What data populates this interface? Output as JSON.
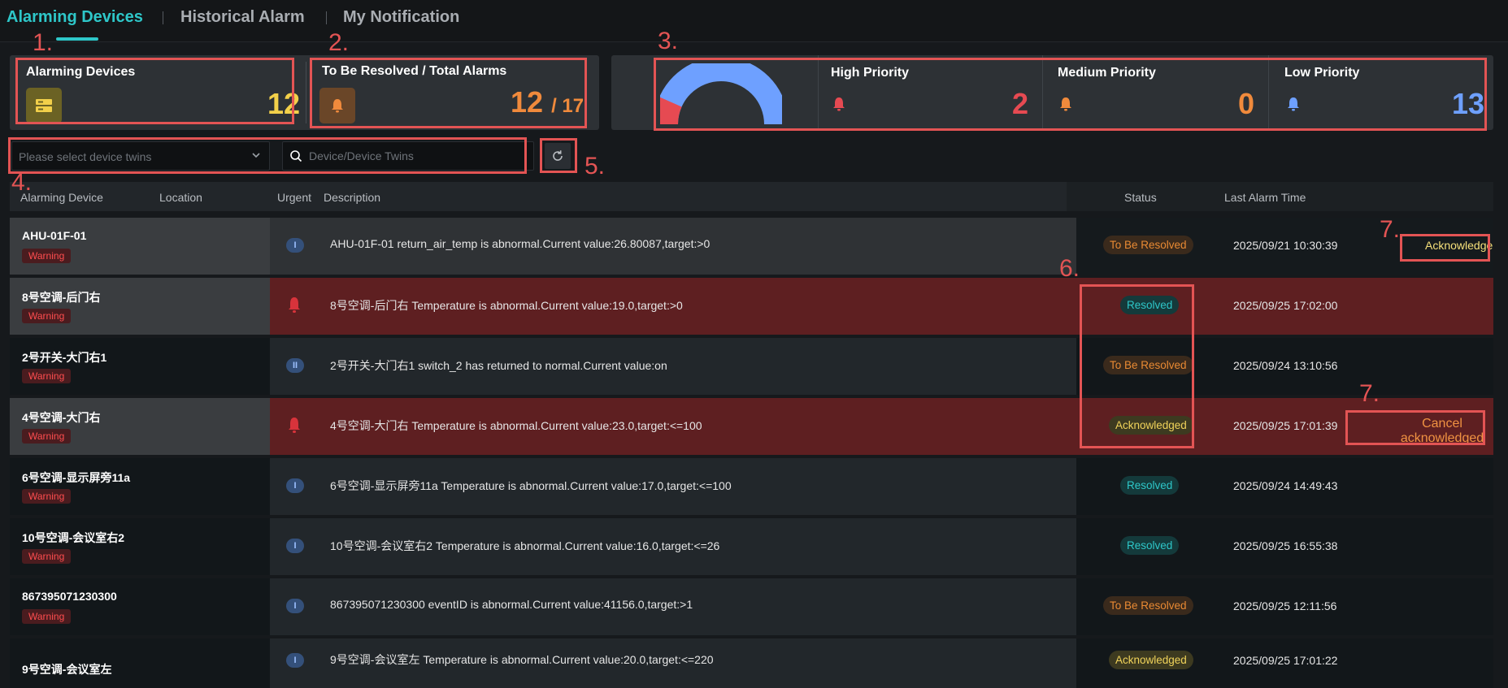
{
  "tabs": [
    {
      "label": "Alarming Devices"
    },
    {
      "label": "Historical Alarm"
    },
    {
      "label": "My Notification"
    }
  ],
  "annotations": [
    "1.",
    "2.",
    "3.",
    "4.",
    "5.",
    "6.",
    "7.",
    "7."
  ],
  "summary": {
    "alarming_devices": {
      "title": "Alarming Devices",
      "count": "12"
    },
    "to_be_resolved": {
      "title": "To Be Resolved / Total Alarms",
      "count": "12",
      "total": "/ 17"
    }
  },
  "priority": {
    "high": {
      "title": "High Priority",
      "count": "2",
      "color": "#e64a52"
    },
    "medium": {
      "title": "Medium Priority",
      "count": "0",
      "color": "#f08a3c"
    },
    "low": {
      "title": "Low Priority",
      "count": "13",
      "color": "#6ea0ff"
    },
    "gauge_fraction_high": 0.133
  },
  "filters": {
    "select_placeholder": "Please select device twins",
    "search_placeholder": "Device/Device Twins"
  },
  "table": {
    "headers": {
      "device": "Alarming Device",
      "location": "Location",
      "urgent": "Urgent",
      "description": "Description",
      "status": "Status",
      "time": "Last Alarm Time"
    },
    "rows": [
      {
        "name": "AHU-01F-01",
        "tag": "Warning",
        "urgent": "I",
        "desc": "AHU-01F-01 return_air_temp is abnormal.Current value:26.80087,target:>0",
        "status": "To Be Resolved",
        "time": "2025/09/21 10:30:39",
        "action": "Acknowledge"
      },
      {
        "name": "8号空调-后门右",
        "tag": "Warning",
        "urgent": "bell",
        "desc": "8号空调-后门右 Temperature is abnormal.Current value:19.0,target:>0",
        "status": "Resolved",
        "time": "2025/09/25 17:02:00",
        "action": ""
      },
      {
        "name": "2号开关-大门右1",
        "tag": "Warning",
        "urgent": "II",
        "desc": "2号开关-大门右1 switch_2 has returned to normal.Current value:on",
        "status": "To Be Resolved",
        "time": "2025/09/24 13:10:56",
        "action": ""
      },
      {
        "name": "4号空调-大门右",
        "tag": "Warning",
        "urgent": "bell",
        "desc": "4号空调-大门右 Temperature is abnormal.Current value:23.0,target:<=100",
        "status": "Acknowledged",
        "time": "2025/09/25 17:01:39",
        "action": "Cancel acknowledged"
      },
      {
        "name": "6号空调-显示屏旁11a",
        "tag": "Warning",
        "urgent": "I",
        "desc": "6号空调-显示屏旁11a Temperature is abnormal.Current value:17.0,target:<=100",
        "status": "Resolved",
        "time": "2025/09/24 14:49:43",
        "action": ""
      },
      {
        "name": "10号空调-会议室右2",
        "tag": "Warning",
        "urgent": "I",
        "desc": "10号空调-会议室右2 Temperature is abnormal.Current value:16.0,target:<=26",
        "status": "Resolved",
        "time": "2025/09/25 16:55:38",
        "action": ""
      },
      {
        "name": "867395071230300",
        "tag": "Warning",
        "urgent": "I",
        "desc": "867395071230300 eventID is abnormal.Current value:41156.0,target:>1",
        "status": "To Be Resolved",
        "time": "2025/09/25 12:11:56",
        "action": ""
      },
      {
        "name": "9号空调-会议室左",
        "tag": "",
        "urgent": "I",
        "desc": "9号空调-会议室左 Temperature is abnormal.Current value:20.0,target:<=220",
        "status": "Acknowledged",
        "time": "2025/09/25 17:01:22",
        "action": ""
      }
    ]
  }
}
